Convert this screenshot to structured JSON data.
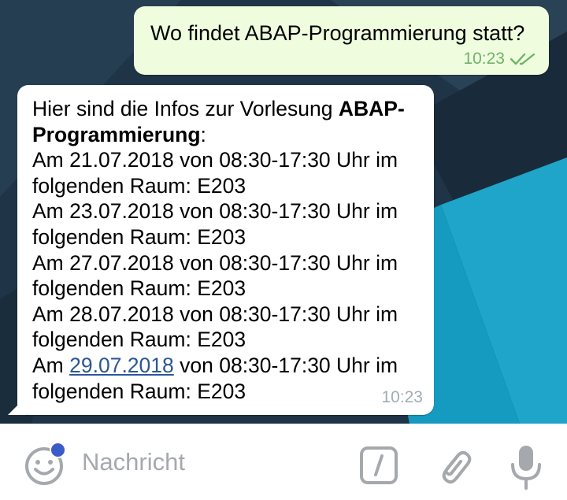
{
  "chat": {
    "outgoing": {
      "text": "Wo findet ABAP-Programmierung statt?",
      "time": "10:23",
      "status": "read"
    },
    "incoming": {
      "intro": "Hier sind die Infos zur Vorlesung ",
      "course_line1": "ABAP-",
      "course_line2": "Programmierung",
      "course_suffix": ":",
      "time": "10:23",
      "sessions": [
        {
          "prefix": "Am ",
          "date": "21.07.2018",
          "rest": " von 08:30-17:30 Uhr im",
          "room_line": "folgenden Raum: E203"
        },
        {
          "prefix": "Am ",
          "date": "23.07.2018",
          "rest": " von 08:30-17:30 Uhr im",
          "room_line": "folgenden Raum: E203"
        },
        {
          "prefix": "Am ",
          "date": "27.07.2018",
          "rest": " von 08:30-17:30 Uhr im",
          "room_line": "folgenden Raum: E203"
        },
        {
          "prefix": "Am ",
          "date": "28.07.2018",
          "rest": " von 08:30-17:30 Uhr im",
          "room_line": "folgenden Raum: E203"
        },
        {
          "prefix": "Am ",
          "date": "29.07.2018",
          "rest": " von 08:30-17:30 Uhr im",
          "room_line": "folgenden Raum: E203",
          "date_is_link": true
        }
      ]
    }
  },
  "composer": {
    "placeholder": "Nachricht",
    "icons": [
      "emoji-icon",
      "bot-command-icon",
      "paperclip-icon",
      "microphone-icon"
    ]
  },
  "colors": {
    "outgoing_bubble": "#effdde",
    "outgoing_meta": "#6fb36a",
    "incoming_bubble": "#ffffff",
    "incoming_meta": "#a0acb6",
    "link": "#2b5796",
    "wallpaper_dark": "#1f3446",
    "wallpaper_cyan": "#1ea5c9",
    "notification_dot": "#3b5bc8",
    "icon_gray": "#a5a9ad"
  }
}
